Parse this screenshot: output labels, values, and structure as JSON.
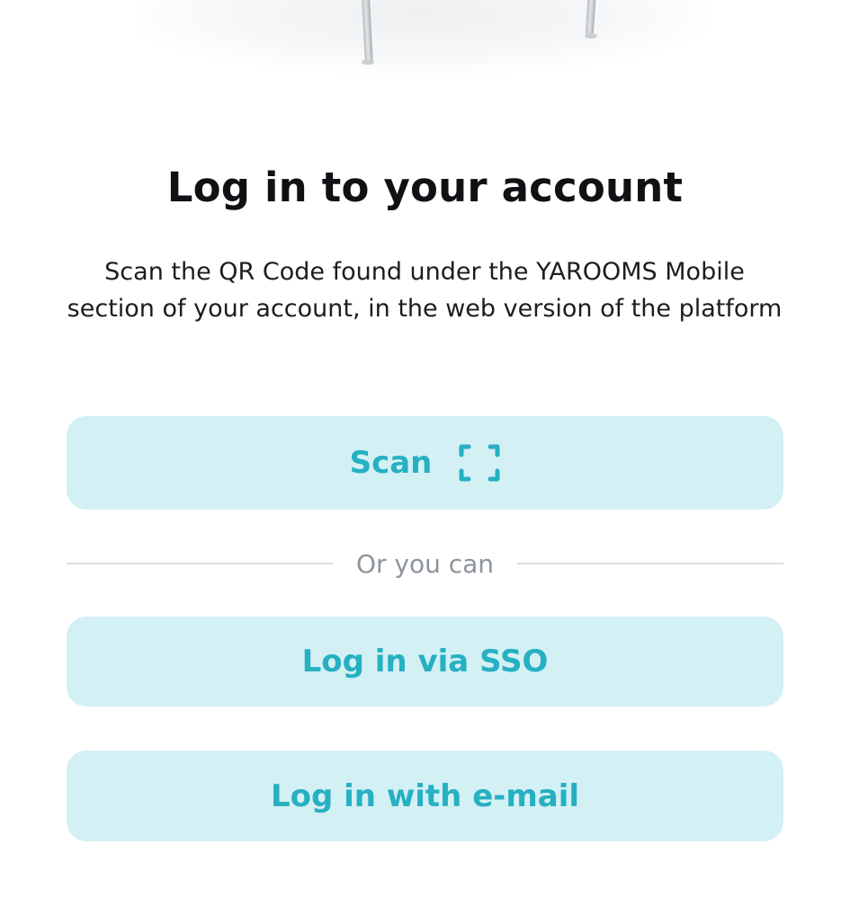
{
  "header": {
    "illustration": "office-chair-illustration"
  },
  "login": {
    "title": "Log in to your account",
    "description": "Scan the QR Code found under the YAROOMS Mobile section of your account, in the web version of the platform",
    "scan_button_label": "Scan",
    "scan_icon": "qr-scan-frame-icon",
    "divider_text": "Or you can",
    "sso_button_label": "Log in via SSO",
    "email_button_label": "Log in with e-mail"
  },
  "colors": {
    "accent": "#26b0c2",
    "button_background": "#d3f0f4",
    "title": "#101114",
    "muted": "#8e949c",
    "background": "#ffffff"
  }
}
